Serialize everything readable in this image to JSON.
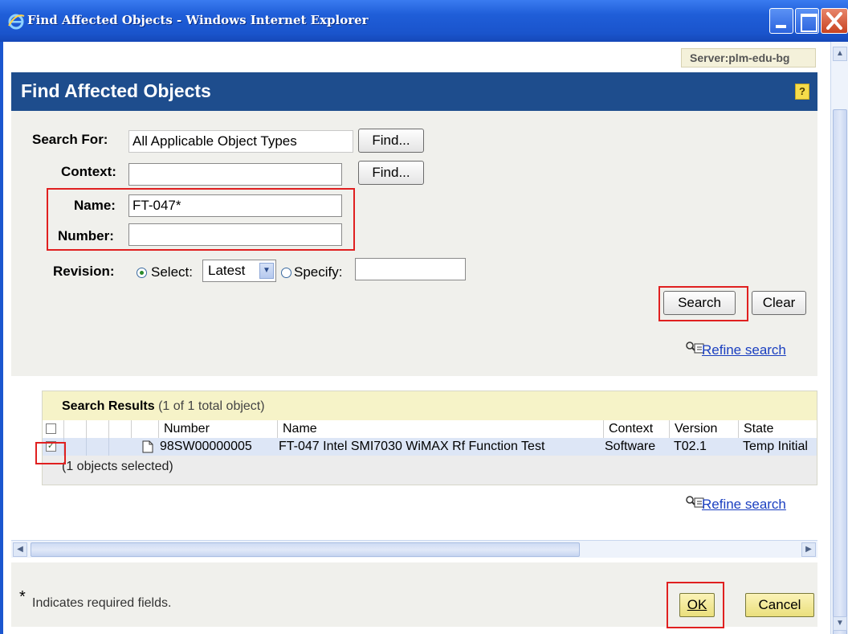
{
  "window": {
    "title": "Find Affected Objects - Windows Internet Explorer"
  },
  "server_label": "Server:plm-edu-bg",
  "page_title": "Find Affected Objects",
  "help_icon": "?",
  "form": {
    "search_for": {
      "label": "Search For:",
      "value": "All Applicable Object Types",
      "find_label": "Find..."
    },
    "context": {
      "label": "Context:",
      "value": "",
      "find_label": "Find..."
    },
    "name": {
      "label": "Name:",
      "value": "FT-047*"
    },
    "number": {
      "label": "Number:",
      "value": ""
    },
    "revision": {
      "label": "Revision:",
      "select_label": "Select:",
      "select_value": "Latest",
      "specify_label": "Specify:",
      "specify_value": "",
      "selected_option": "select"
    },
    "search_button": "Search",
    "clear_button": "Clear",
    "refine_search": "Refine search"
  },
  "results": {
    "title": "Search Results",
    "count": "(1 of 1 total object)",
    "columns": [
      "Number",
      "Name",
      "Context",
      "Version",
      "State"
    ],
    "rows": [
      {
        "checked": true,
        "number": "98SW00000005",
        "name": "FT-047 Intel SMI7030 WiMAX Rf Function Test",
        "context": "Software",
        "version": "T02.1",
        "state": "Temp Initial"
      }
    ],
    "selected_note": "(1 objects selected)",
    "refine_search": "Refine search"
  },
  "footer": {
    "required_star": "*",
    "required_note": "Indicates required fields.",
    "ok_button": "OK",
    "cancel_button": "Cancel"
  },
  "colors": {
    "titlebar": "#1f5ed8",
    "header_bar": "#1e4d8d",
    "highlight_box": "#e02020",
    "results_header": "#f6f3c8",
    "selected_row": "#dde6f6",
    "ok_button": "#eadf7c"
  }
}
